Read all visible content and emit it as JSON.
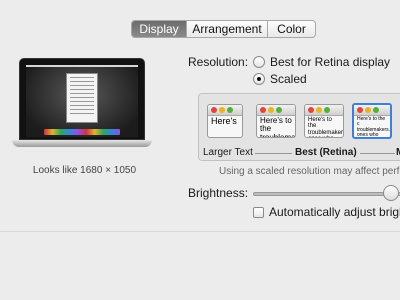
{
  "tabs": [
    "Display",
    "Arrangement",
    "Color"
  ],
  "active_tab": "Display",
  "preview": {
    "caption": "Looks like 1680 × 1050"
  },
  "resolution": {
    "label": "Resolution:",
    "options": [
      "Best for Retina display",
      "Scaled"
    ],
    "selected": "Scaled"
  },
  "scale_options": [
    {
      "preview_text": "Here's"
    },
    {
      "preview_text": "Here's to the\ntroublemakers"
    },
    {
      "preview_text": "Here's to the\ntroublemakers,\nones who see t\nrules. And the"
    },
    {
      "preview_text": "Here's to the c\ntroublemakers.\nones who see t\nrules. And they"
    }
  ],
  "selected_scale_index": 3,
  "scale_labels": {
    "left": "Larger Text",
    "best": "Best (Retina)",
    "right_cut": "M"
  },
  "warning": "Using a scaled resolution may affect perform",
  "brightness": {
    "label": "Brightness:",
    "value": 0.87
  },
  "auto_brightness": {
    "label": "Automatically adjust bright",
    "checked": false
  },
  "colors": {
    "selection": "#3f7fd6",
    "active_tab": "#7a7a7a"
  }
}
